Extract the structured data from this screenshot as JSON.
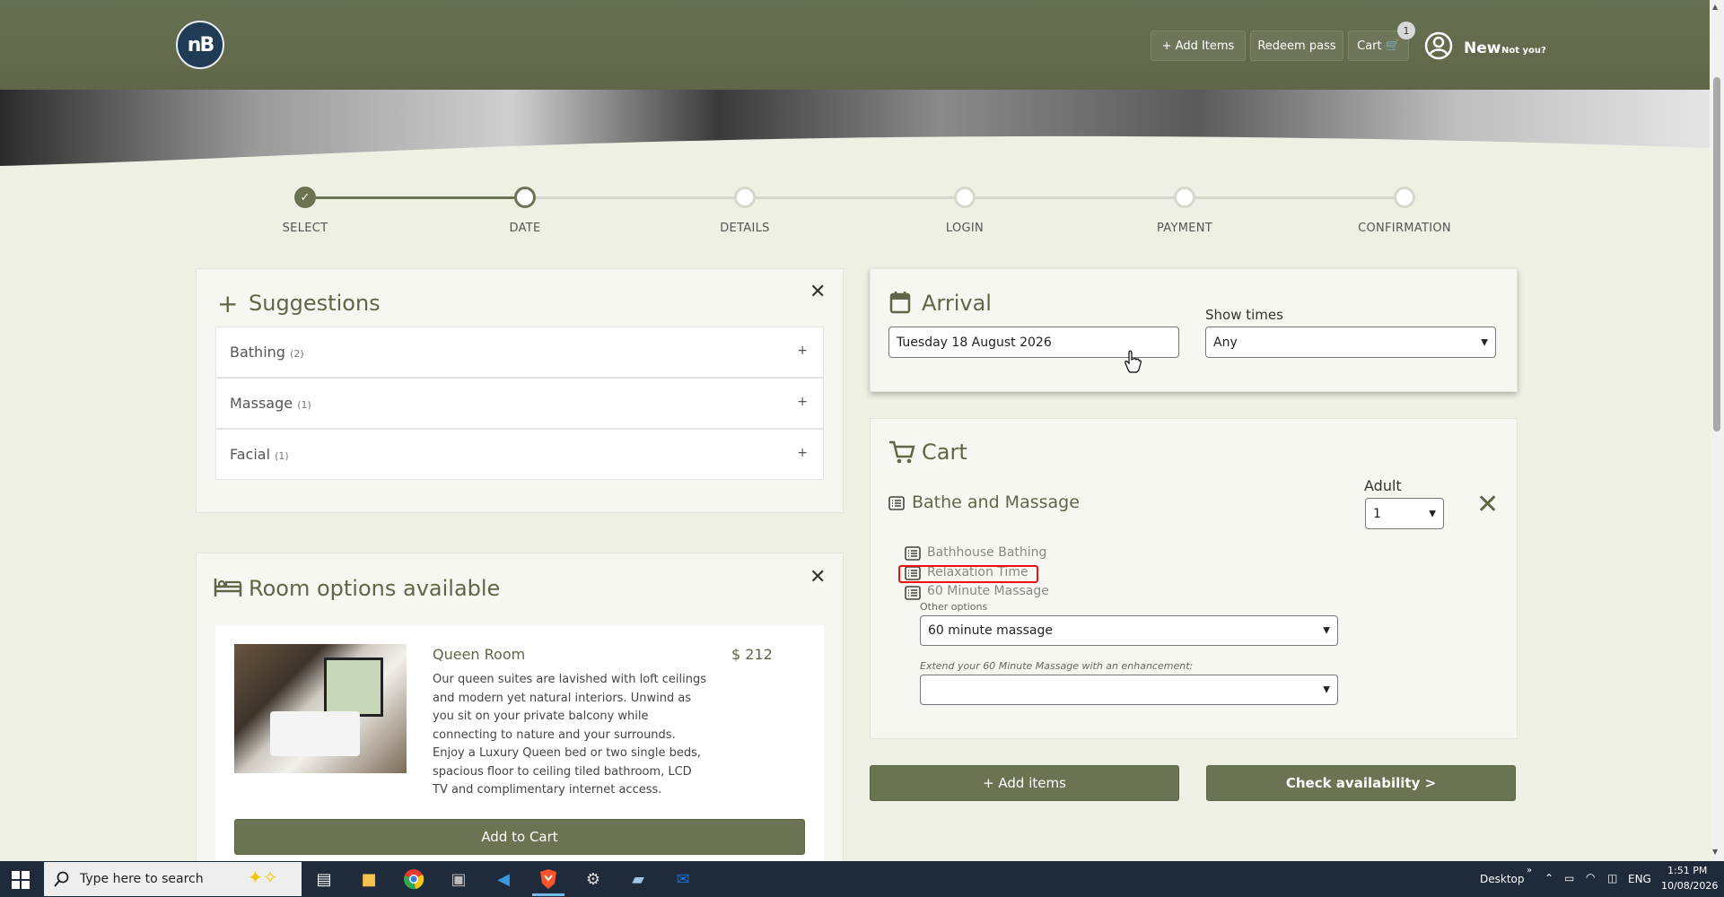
{
  "header": {
    "logo_text": "nB",
    "add_items": "+ Add Items",
    "redeem_pass": "Redeem pass",
    "cart": "Cart 🛒",
    "cart_count": "1",
    "user_name": "New",
    "not_you": "Not you?"
  },
  "stepper": {
    "steps": [
      "SELECT",
      "DATE",
      "DETAILS",
      "LOGIN",
      "PAYMENT",
      "CONFIRMATION"
    ],
    "current_step": "DATE"
  },
  "suggestions": {
    "title": "Suggestions",
    "items": [
      {
        "name": "Bathing",
        "count": "(2)"
      },
      {
        "name": "Massage",
        "count": "(1)"
      },
      {
        "name": "Facial",
        "count": "(1)"
      }
    ]
  },
  "rooms": {
    "title": "Room options available",
    "room": {
      "name": "Queen Room",
      "price": "$ 212",
      "description": "Our queen suites are lavished with loft ceilings and modern yet natural interiors.  Unwind as you sit on your private balcony while connecting to nature and your surrounds. Enjoy a Luxury Queen bed or two single beds, spacious floor to ceiling tiled bathroom, LCD TV and complimentary internet access.",
      "add_to_cart": "Add to Cart"
    }
  },
  "arrival": {
    "title": "Arrival",
    "date_value": "Tuesday 18 August 2026",
    "show_times_label": "Show times",
    "show_times_value": "Any"
  },
  "cart": {
    "title": "Cart",
    "package_name": "Bathe and Massage",
    "adult_label": "Adult",
    "adult_value": "1",
    "items": [
      "Bathhouse Bathing",
      "Relaxation Time",
      "60 Minute Massage"
    ],
    "other_options_label": "Other options",
    "other_options_value": "60 minute massage",
    "extend_label": "Extend your 60 Minute Massage with an enhancement:",
    "extend_value": "",
    "add_items": "+ Add items",
    "check_availability": "Check availability >"
  },
  "taskbar": {
    "search_placeholder": "Type here to search",
    "desktop": "Desktop",
    "language": "ENG",
    "time": "1:51 PM",
    "date": "10/08/2026"
  },
  "colors": {
    "accent": "#6b7452",
    "highlight": "#e11111"
  }
}
